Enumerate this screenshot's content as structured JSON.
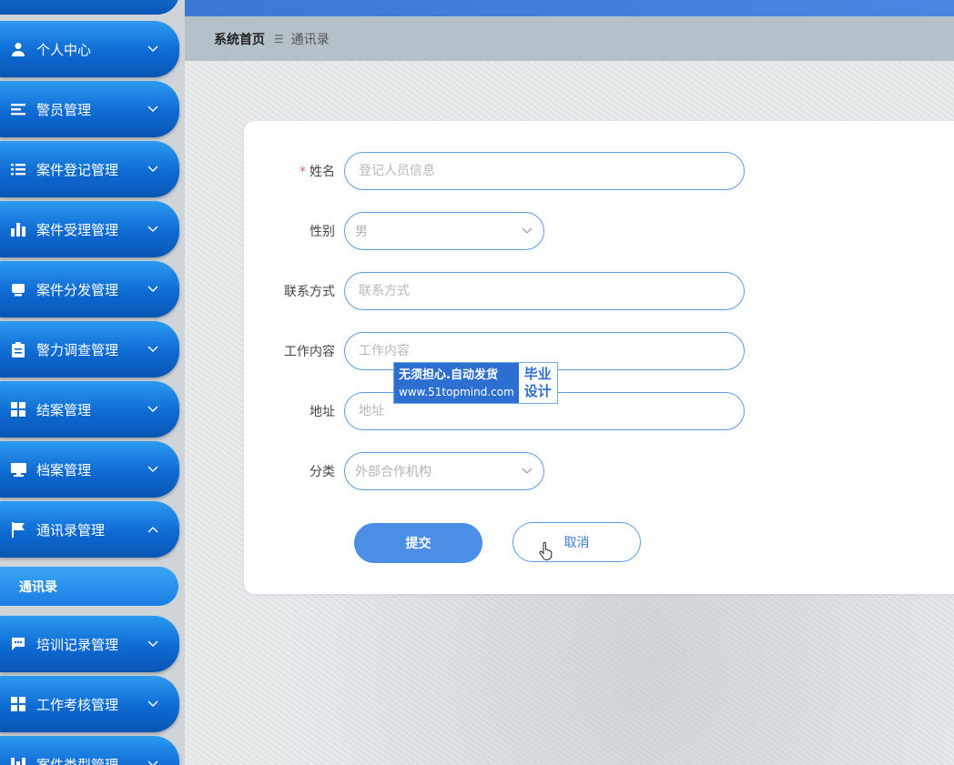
{
  "sidebar": {
    "items": [
      {
        "label": "个人中心",
        "icon": "user-icon",
        "expanded": false
      },
      {
        "label": "警员管理",
        "icon": "list-icon",
        "expanded": false
      },
      {
        "label": "案件登记管理",
        "icon": "list-indent-icon",
        "expanded": false
      },
      {
        "label": "案件受理管理",
        "icon": "bar-chart-icon",
        "expanded": false
      },
      {
        "label": "案件分发管理",
        "icon": "inbox-icon",
        "expanded": false
      },
      {
        "label": "警力调查管理",
        "icon": "clipboard-icon",
        "expanded": false
      },
      {
        "label": "结案管理",
        "icon": "grid-icon",
        "expanded": false
      },
      {
        "label": "档案管理",
        "icon": "monitor-icon",
        "expanded": false
      },
      {
        "label": "通讯录管理",
        "icon": "flag-icon",
        "expanded": true
      },
      {
        "label": "培训记录管理",
        "icon": "chat-icon",
        "expanded": false
      },
      {
        "label": "工作考核管理",
        "icon": "grid-icon",
        "expanded": false
      },
      {
        "label": "案件类型管理",
        "icon": "bars-icon",
        "expanded": false
      }
    ],
    "submenu_active": "通讯录"
  },
  "breadcrumb": {
    "home": "系统首页",
    "separator": "☰",
    "current": "通讯录"
  },
  "form": {
    "name": {
      "label": "姓名",
      "required": true,
      "placeholder": "登记人员信息",
      "value": ""
    },
    "gender": {
      "label": "性别",
      "value": "男"
    },
    "contact": {
      "label": "联系方式",
      "placeholder": "联系方式",
      "value": ""
    },
    "work": {
      "label": "工作内容",
      "placeholder": "工作内容",
      "value": ""
    },
    "address": {
      "label": "地址",
      "placeholder": "地址",
      "value": ""
    },
    "category": {
      "label": "分类",
      "value": "外部合作机构"
    },
    "submit_label": "提交",
    "cancel_label": "取消"
  },
  "watermark": {
    "line1": "无须担心.自动发货",
    "line2": "www.51topmind.com",
    "right_top": "毕业",
    "right_bottom": "设计"
  },
  "colors": {
    "sidebar_item": "#0e6ad2",
    "accent": "#4a8ee6",
    "input_border": "#5b9ce8",
    "required": "#e95f5f"
  }
}
